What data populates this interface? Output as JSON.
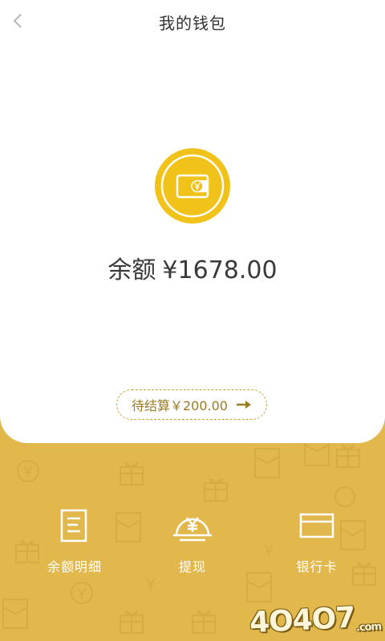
{
  "header": {
    "title": "我的钱包"
  },
  "wallet": {
    "balance_label": "余额",
    "currency_symbol": "¥",
    "balance_amount": "1678.00"
  },
  "pending": {
    "text": "待结算￥200.00"
  },
  "actions": [
    {
      "label": "余额明细"
    },
    {
      "label": "提现"
    },
    {
      "label": "银行卡"
    }
  ],
  "watermark": {
    "text": "4O4O7",
    "suffix": ".com"
  },
  "colors": {
    "accent": "#f0c21a",
    "bottom_background": "#e2b84d",
    "pill_border": "#c9a23a"
  }
}
